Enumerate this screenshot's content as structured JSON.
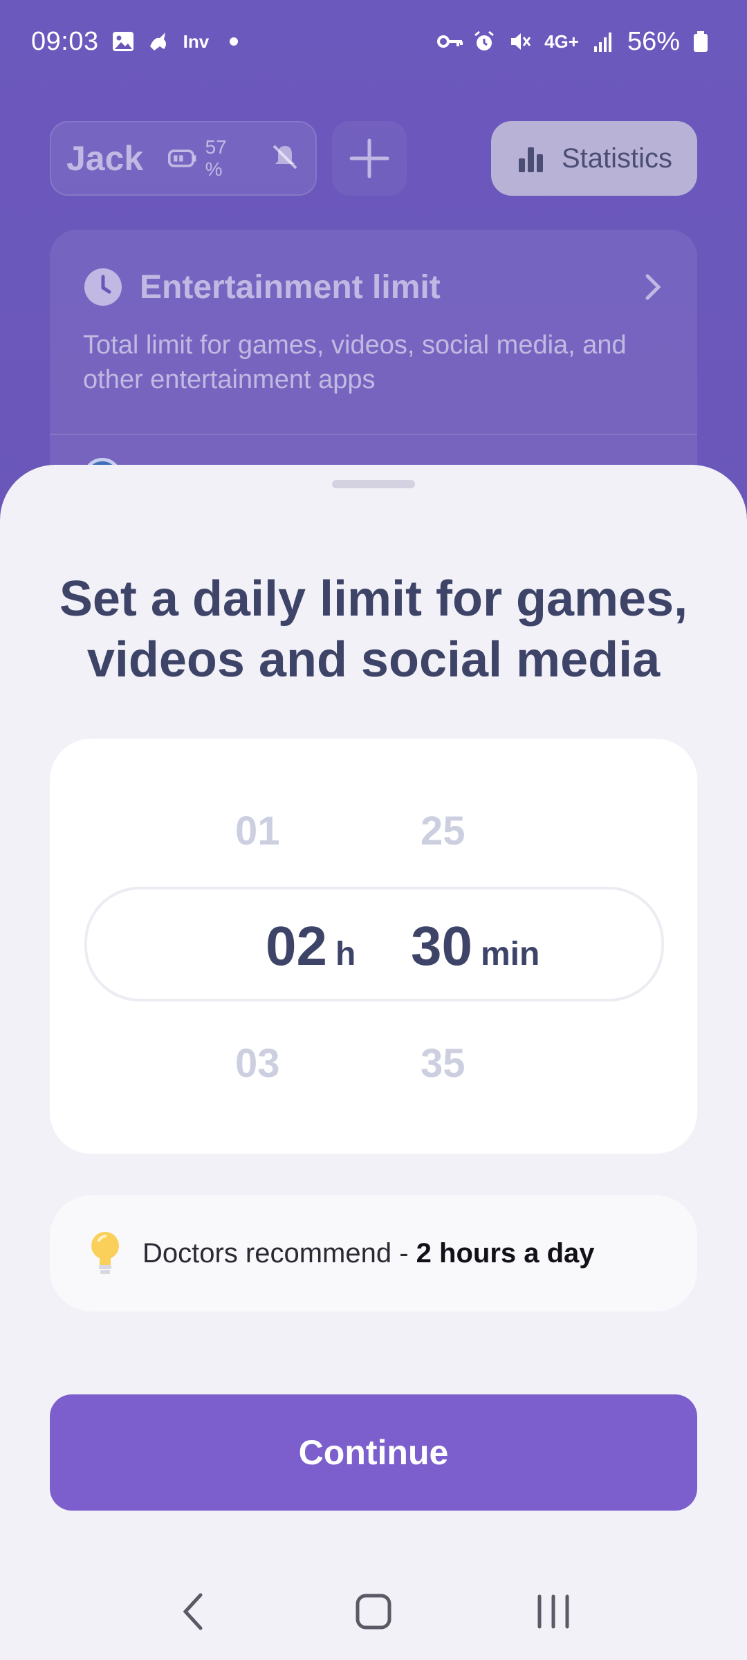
{
  "status_bar": {
    "time": "09:03",
    "carrier_text": "Inv",
    "network_label": "4G+",
    "battery_percent": "56%"
  },
  "header": {
    "profile_name": "Jack",
    "device_battery": "57 %",
    "statistics_label": "Statistics"
  },
  "entertainment_card": {
    "title": "Entertainment limit",
    "description": "Total limit for games, videos, social media, and other entertainment apps"
  },
  "sheet": {
    "title": "Set a daily limit for games, videos and social media",
    "picker": {
      "hours_prev": "01",
      "hours_selected": "02",
      "hours_next": "03",
      "hours_unit": "h",
      "minutes_prev": "25",
      "minutes_selected": "30",
      "minutes_next": "35",
      "minutes_unit": "min"
    },
    "tip": {
      "text": "Doctors recommend - ",
      "emphasis": "2 hours a day",
      "icon": "lightbulb-icon"
    },
    "continue_label": "Continue"
  },
  "nav": {
    "back_icon": "back-icon",
    "home_icon": "home-icon",
    "recents_icon": "recents-icon"
  },
  "colors": {
    "accent": "#7c5fcc",
    "background_purple": "#6a55b6",
    "title_text": "#3e4468",
    "sheet_bg": "#f3f1f8"
  }
}
